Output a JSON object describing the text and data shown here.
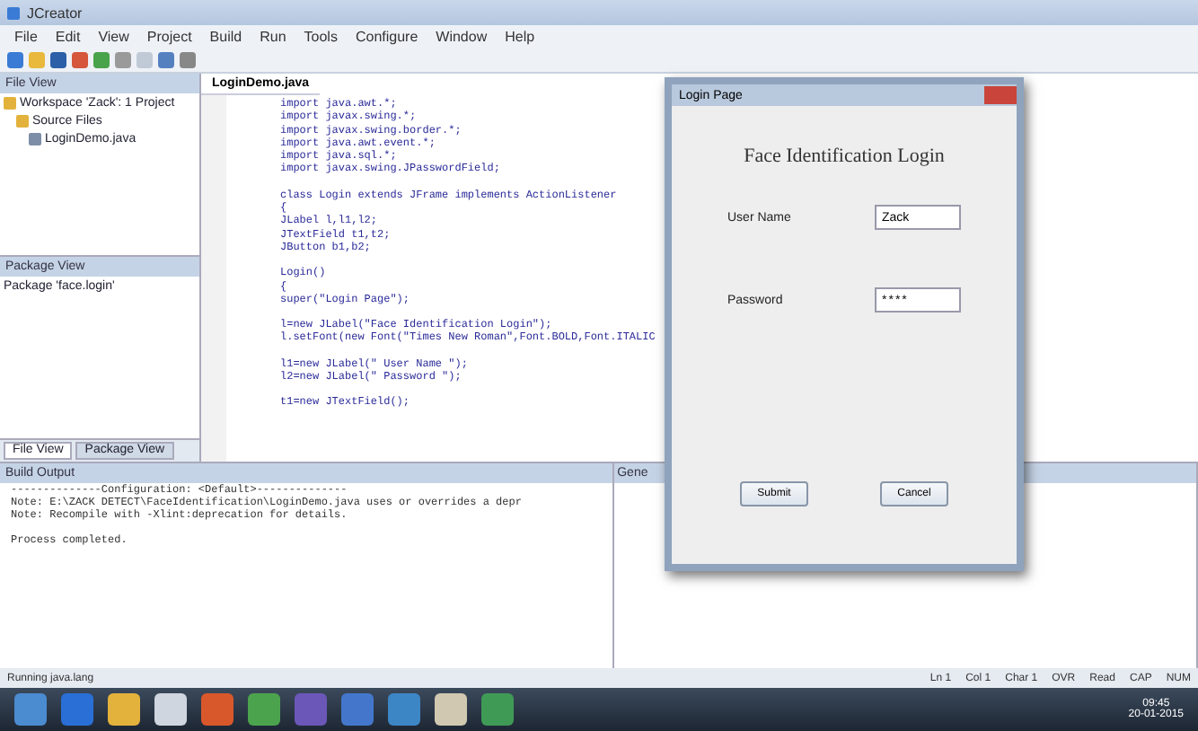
{
  "window": {
    "title": "JCreator"
  },
  "menu": [
    "File",
    "Edit",
    "View",
    "Project",
    "Build",
    "Run",
    "Tools",
    "Configure",
    "Window",
    "Help"
  ],
  "file_view": {
    "title": "File View",
    "tree": [
      {
        "label": "Workspace 'Zack': 1 Project",
        "children": [
          {
            "label": "Source Files",
            "children": [
              {
                "label": "LoginDemo.java"
              }
            ]
          }
        ]
      }
    ]
  },
  "package_view": {
    "title": "Package View",
    "items": [
      "Package 'face.login'"
    ]
  },
  "panel_tabs": [
    {
      "label": "File View",
      "selected": true
    },
    {
      "label": "Package View",
      "selected": false
    }
  ],
  "editor": {
    "tab": "LoginDemo.java",
    "blocks": [
      [
        "import java.awt.*;",
        "import javax.swing.*;",
        "import javax.swing.border.*;",
        "import java.awt.event.*;",
        "import java.sql.*;",
        "import javax.swing.JPasswordField;"
      ],
      [
        "class Login extends JFrame implements ActionListener",
        "{",
        "JLabel l,l1,l2;",
        "JTextField t1,t2;",
        "JButton b1,b2;"
      ],
      [
        "Login()",
        "{",
        "super(\"Login Page\");"
      ],
      [
        "l=new JLabel(\"Face Identification Login\");",
        "l.setFont(new Font(\"Times New Roman\",Font.BOLD,Font.ITALIC"
      ],
      [
        "l1=new JLabel(\" User Name \");",
        "l2=new JLabel(\" Password \");"
      ],
      [
        "t1=new JTextField();"
      ]
    ]
  },
  "build_output": {
    "title": "Build Output",
    "blocks": [
      [
        "--------------Configuration: <Default>--------------",
        "Note: E:\\ZACK DETECT\\FaceIdentification\\LoginDemo.java uses or overrides a depr",
        "Note: Recompile with -Xlint:deprecation for details."
      ],
      [
        "Process completed."
      ]
    ]
  },
  "second_output": {
    "title": "Gene"
  },
  "dialog": {
    "title": "Login Page",
    "heading": "Face Identification Login",
    "fields": [
      {
        "label": "User Name",
        "value": "Zack",
        "kind": "text"
      },
      {
        "label": "Password",
        "value": "****",
        "kind": "password"
      }
    ],
    "buttons": [
      "Submit",
      "Cancel"
    ]
  },
  "status_bar": {
    "left": "Running java.lang",
    "right": [
      "Ln 1",
      "Col 1",
      "Char 1",
      "OVR",
      "Read",
      "CAP",
      "NUM"
    ]
  },
  "taskbar": {
    "clock": "09:45",
    "date": "20-01-2015"
  }
}
